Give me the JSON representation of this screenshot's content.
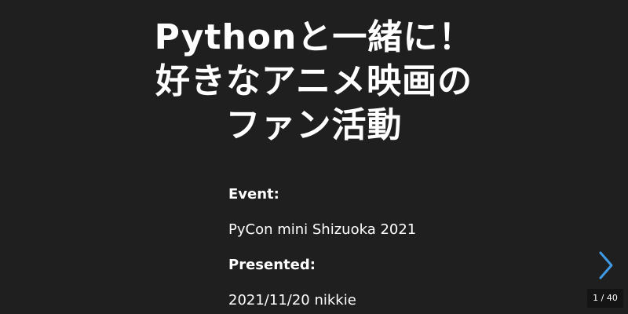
{
  "slide": {
    "title_lines": [
      "Pythonと一緒に！",
      "好きなアニメ映画の",
      "ファン活動"
    ],
    "event_label": "Event:",
    "event_value": "PyCon mini Shizuoka 2021",
    "presented_label": "Presented:",
    "presented_value": "2021/11/20 nikkie"
  },
  "nav": {
    "next_icon": "chevron-right-icon",
    "accent_color": "#3f9ae8"
  },
  "counter": {
    "current": "1",
    "separator": "/",
    "total": "40"
  },
  "colors": {
    "background": "#1f1f1f",
    "text": "#ffffff"
  }
}
